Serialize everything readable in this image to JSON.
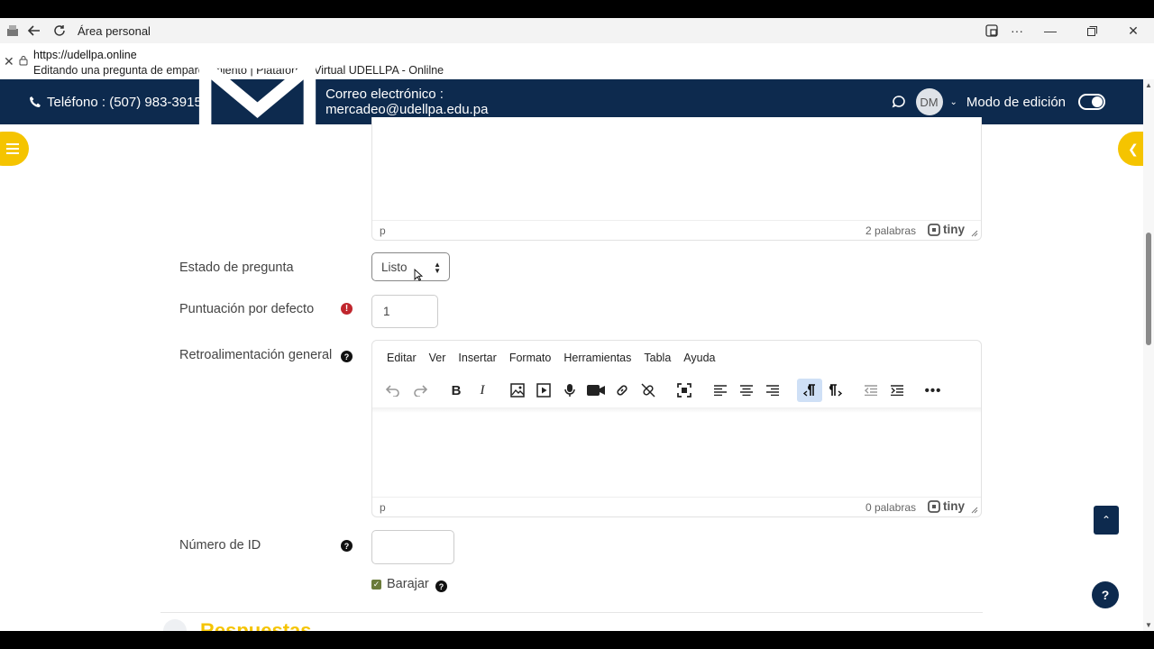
{
  "window": {
    "title": "Área personal"
  },
  "address": {
    "url": "https://udellpa.online",
    "page_title": "Editando una pregunta de emparejamiento | Plataforma Virtual UDELLPA - Onlilne"
  },
  "header": {
    "phone": "Teléfono : (507) 983-3915",
    "email": "Correo electrónico : mercadeo@udellpa.edu.pa",
    "avatar_initials": "DM",
    "edit_mode_label": "Modo de edición",
    "edit_mode_on": true
  },
  "editor_top": {
    "path": "p",
    "word_count": "2 palabras",
    "brand": "tiny"
  },
  "form": {
    "estado_label": "Estado de pregunta",
    "estado_value": "Listo",
    "puntuacion_label": "Puntuación por defecto",
    "puntuacion_value": "1",
    "retro_label": "Retroalimentación general",
    "numero_id_label": "Número de ID",
    "numero_id_value": "",
    "barajar_label": "Barajar",
    "barajar_checked": true,
    "next_section": "Respuestas"
  },
  "editor_feedback": {
    "menu": [
      "Editar",
      "Ver",
      "Insertar",
      "Formato",
      "Herramientas",
      "Tabla",
      "Ayuda"
    ],
    "path": "p",
    "word_count": "0 palabras",
    "brand": "tiny"
  },
  "floating": {
    "help_symbol": "?"
  },
  "colors": {
    "navy": "#0d2a4e",
    "accent_yellow": "#f5c400",
    "required_red": "#c0262d"
  }
}
